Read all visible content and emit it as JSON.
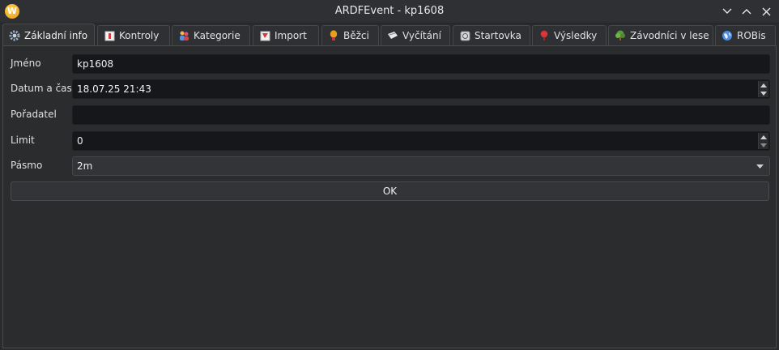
{
  "window": {
    "title": "ARDFEvent - kp1608",
    "app_icon_letter": "W"
  },
  "tabs": [
    {
      "label": "Základní info",
      "icon": "gear-icon",
      "active": true
    },
    {
      "label": "Kontroly",
      "icon": "control-flag-icon"
    },
    {
      "label": "Kategorie",
      "icon": "people-icon"
    },
    {
      "label": "Import",
      "icon": "import-icon"
    },
    {
      "label": "Běžci",
      "icon": "runner-icon"
    },
    {
      "label": "Vyčítání",
      "icon": "readout-icon"
    },
    {
      "label": "Startovka",
      "icon": "start-list-icon"
    },
    {
      "label": "Výsledky",
      "icon": "results-icon"
    },
    {
      "label": "Závodníci v lese",
      "icon": "tree-icon"
    },
    {
      "label": "ROBis",
      "icon": "globe-icon"
    }
  ],
  "form": {
    "name_label": "Jméno",
    "name_value": "kp1608",
    "datetime_label": "Datum a čas",
    "datetime_value": "18.07.25 21:43",
    "organizer_label": "Pořadatel",
    "organizer_value": "",
    "limit_label": "Limit",
    "limit_value": "0",
    "band_label": "Pásmo",
    "band_value": "2m",
    "ok_label": "OK"
  }
}
